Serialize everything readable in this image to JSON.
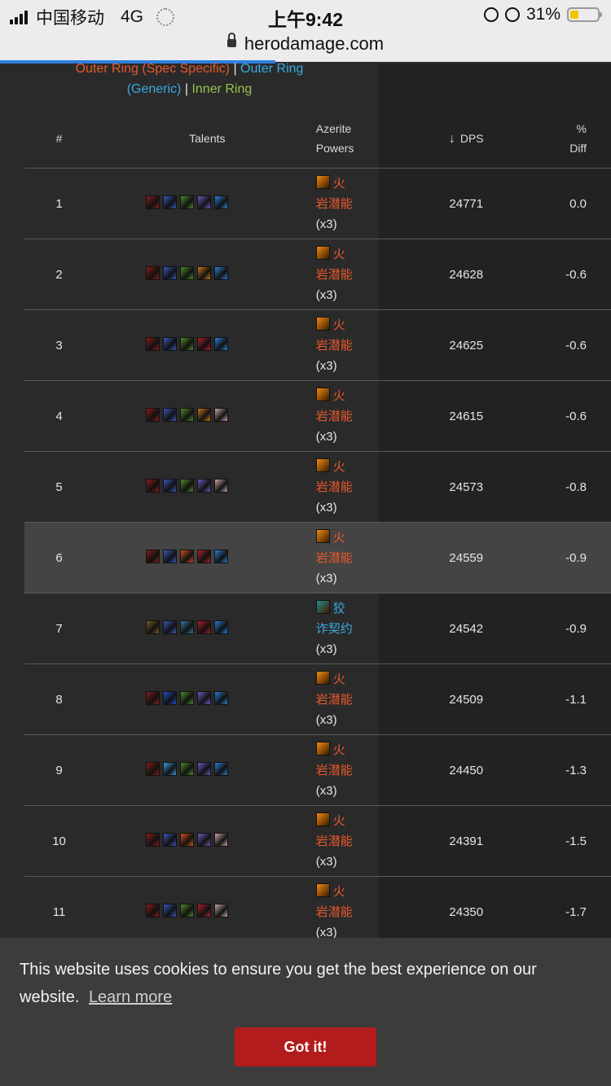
{
  "status_bar": {
    "carrier": "中国移动",
    "network": "4G",
    "time": "上午9:42",
    "battery": "31%",
    "battery_level": 0.31
  },
  "url_bar": {
    "domain": "herodamage.com",
    "load_progress": 0.45
  },
  "legend": {
    "outer_spec": "Outer Ring (Spec Specific)",
    "separator": "|",
    "outer_generic_part1": "Outer Ring",
    "outer_generic_part2": "(Generic)",
    "inner": "Inner Ring"
  },
  "table": {
    "headers": {
      "rank": "#",
      "talents": "Talents",
      "azerite_line1": "Azerite",
      "azerite_line2": "Powers",
      "dps": "DPS",
      "diff_line1": "%",
      "diff_line2": "Diff"
    },
    "rows": [
      {
        "rank": "1",
        "talents": [
          "#8a1c1c",
          "#3b58b8",
          "#4f8a2a",
          "#6a5bc0",
          "#2a7fd4"
        ],
        "az_line1": "火",
        "az_line2": "岩潜能",
        "az_count": "(x3)",
        "az_icon": "#f08a10",
        "az_blue": false,
        "dps": "24771",
        "diff": "0.0",
        "highlighted": false
      },
      {
        "rank": "2",
        "talents": [
          "#8a1c1c",
          "#3b58b8",
          "#4f8a2a",
          "#c8781c",
          "#2a7fd4"
        ],
        "az_line1": "火",
        "az_line2": "岩潜能",
        "az_count": "(x3)",
        "az_icon": "#f08a10",
        "az_blue": false,
        "dps": "24628",
        "diff": "-0.6",
        "highlighted": false
      },
      {
        "rank": "3",
        "talents": [
          "#8a1c1c",
          "#3b58b8",
          "#4f8a2a",
          "#b0202a",
          "#2a7fd4"
        ],
        "az_line1": "火",
        "az_line2": "岩潜能",
        "az_count": "(x3)",
        "az_icon": "#f08a10",
        "az_blue": false,
        "dps": "24625",
        "diff": "-0.6",
        "highlighted": false
      },
      {
        "rank": "4",
        "talents": [
          "#8a1c1c",
          "#3b58b8",
          "#4f8a2a",
          "#c8781c",
          "#c9a6a6"
        ],
        "az_line1": "火",
        "az_line2": "岩潜能",
        "az_count": "(x3)",
        "az_icon": "#f08a10",
        "az_blue": false,
        "dps": "24615",
        "diff": "-0.6",
        "highlighted": false
      },
      {
        "rank": "5",
        "talents": [
          "#8a1c1c",
          "#3b58b8",
          "#4f8a2a",
          "#6a5bc0",
          "#c9a6a6"
        ],
        "az_line1": "火",
        "az_line2": "岩潜能",
        "az_count": "(x3)",
        "az_icon": "#f08a10",
        "az_blue": false,
        "dps": "24573",
        "diff": "-0.8",
        "highlighted": false
      },
      {
        "rank": "6",
        "talents": [
          "#8a1c1c",
          "#3b58b8",
          "#d0501c",
          "#b0202a",
          "#2a7fd4"
        ],
        "az_line1": "火",
        "az_line2": "岩潜能",
        "az_count": "(x3)",
        "az_icon": "#f08a10",
        "az_blue": false,
        "dps": "24559",
        "diff": "-0.9",
        "highlighted": true
      },
      {
        "rank": "7",
        "talents": [
          "#7a5a2a",
          "#3b58b8",
          "#3a7aa0",
          "#b0202a",
          "#2a7fd4"
        ],
        "az_line1": "狡",
        "az_line2": "诈契约",
        "az_count": "(x3)",
        "az_icon": "#2a8a8a",
        "az_blue": true,
        "dps": "24542",
        "diff": "-0.9",
        "highlighted": false
      },
      {
        "rank": "8",
        "talents": [
          "#8a1c1c",
          "#2050c8",
          "#4f8a2a",
          "#6a5bc0",
          "#2a7fd4"
        ],
        "az_line1": "火",
        "az_line2": "岩潜能",
        "az_count": "(x3)",
        "az_icon": "#f08a10",
        "az_blue": false,
        "dps": "24509",
        "diff": "-1.1",
        "highlighted": false
      },
      {
        "rank": "9",
        "talents": [
          "#8a1c1c",
          "#3a9ae0",
          "#4f8a2a",
          "#6a5bc0",
          "#2a7fd4"
        ],
        "az_line1": "火",
        "az_line2": "岩潜能",
        "az_count": "(x3)",
        "az_icon": "#f08a10",
        "az_blue": false,
        "dps": "24450",
        "diff": "-1.3",
        "highlighted": false
      },
      {
        "rank": "10",
        "talents": [
          "#8a1c1c",
          "#3b58b8",
          "#d0501c",
          "#6a5bc0",
          "#c9a6a6"
        ],
        "az_line1": "火",
        "az_line2": "岩潜能",
        "az_count": "(x3)",
        "az_icon": "#f08a10",
        "az_blue": false,
        "dps": "24391",
        "diff": "-1.5",
        "highlighted": false
      },
      {
        "rank": "11",
        "talents": [
          "#8a1c1c",
          "#3b58b8",
          "#4f8a2a",
          "#b0202a",
          "#c9a6a6"
        ],
        "az_line1": "火",
        "az_line2": "岩潜能",
        "az_count": "(x3)",
        "az_icon": "#f08a10",
        "az_blue": false,
        "dps": "24350",
        "diff": "-1.7",
        "highlighted": false
      }
    ]
  },
  "cookie_banner": {
    "message": "This website uses cookies to ensure you get the best experience on our website.",
    "learn_more": "Learn more",
    "button": "Got it!"
  },
  "colors": {
    "accent_orange": "#e8582a",
    "accent_blue": "#39a9e0",
    "accent_green": "#99c24d",
    "button_red": "#b31c1c"
  }
}
